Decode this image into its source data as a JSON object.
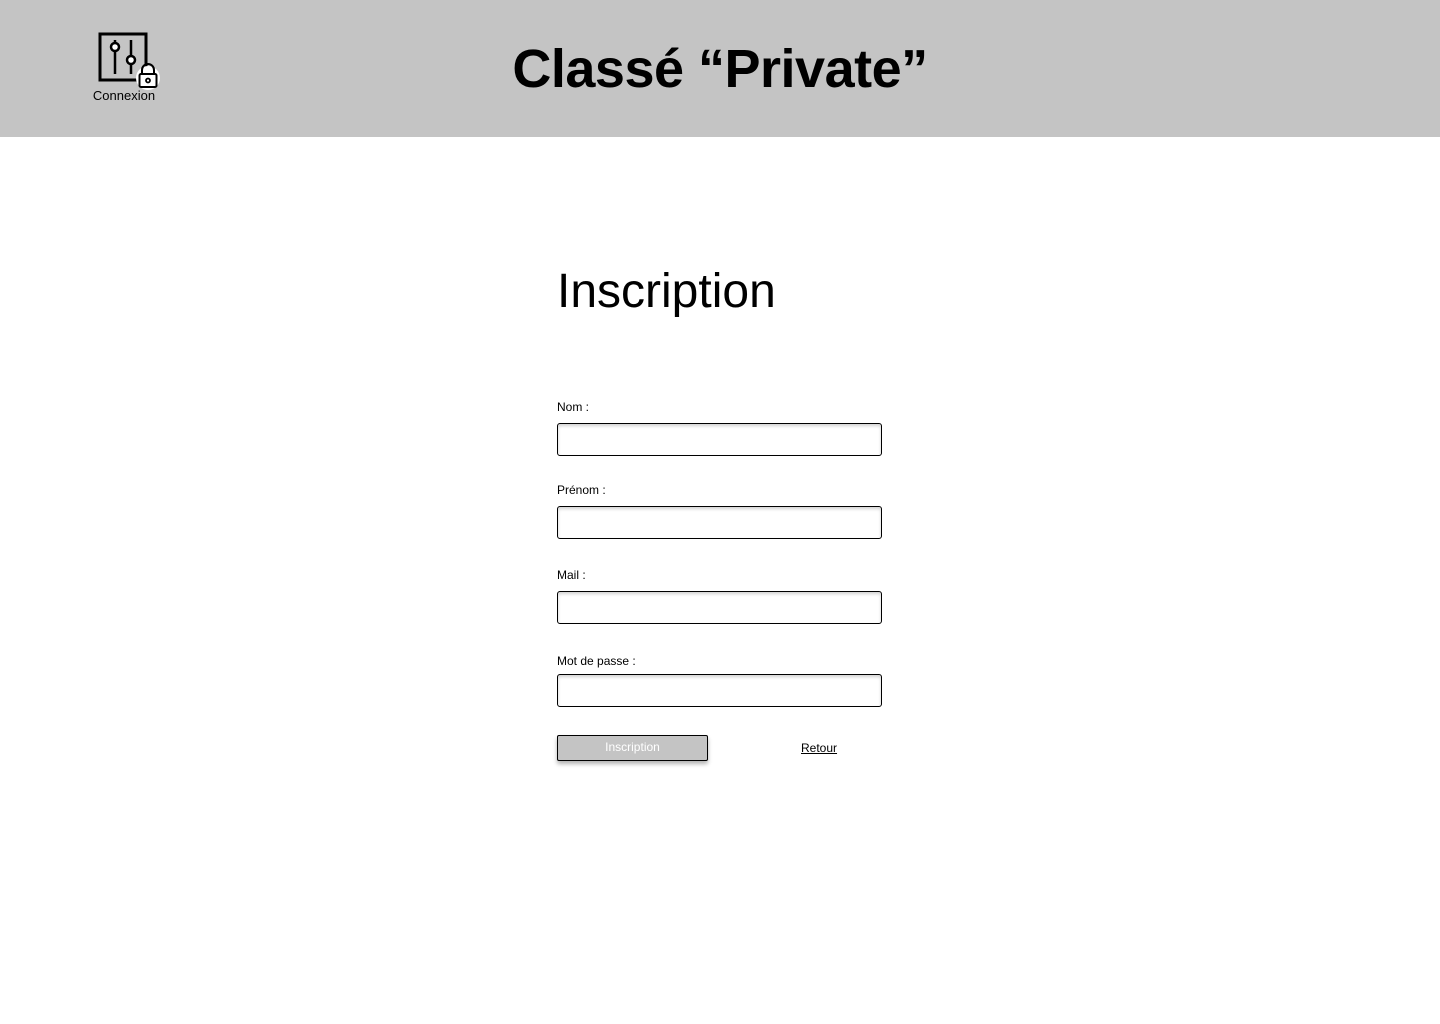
{
  "header": {
    "title": "Classé “Private”",
    "login": {
      "icon": "settings-lock-icon",
      "label": "Connexion"
    },
    "background_color": "#c4c4c4"
  },
  "main": {
    "heading": "Inscription",
    "fields": [
      {
        "label": "Nom :",
        "value": "",
        "placeholder": ""
      },
      {
        "label": "Prénom :",
        "value": "",
        "placeholder": ""
      },
      {
        "label": "Mail :",
        "value": "",
        "placeholder": ""
      },
      {
        "label": "Mot de passe :",
        "value": "",
        "placeholder": ""
      }
    ],
    "submit_label": "Inscription",
    "back_label": "Retour"
  }
}
